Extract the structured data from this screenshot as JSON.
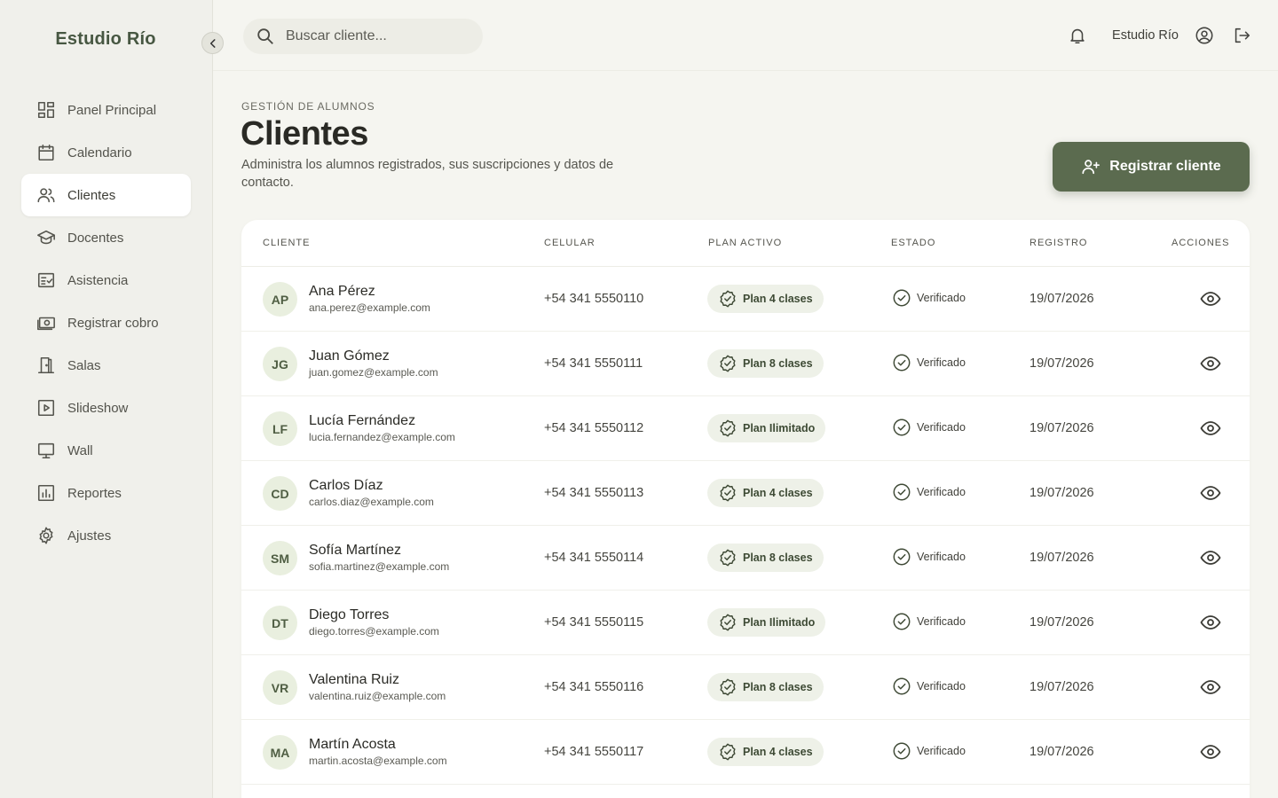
{
  "app": {
    "brand": "Estudio Río"
  },
  "sidebar": {
    "items": [
      {
        "label": "Panel Principal",
        "icon": "dashboard-icon",
        "active": false
      },
      {
        "label": "Calendario",
        "icon": "calendar-icon",
        "active": false
      },
      {
        "label": "Clientes",
        "icon": "users-icon",
        "active": true
      },
      {
        "label": "Docentes",
        "icon": "graduation-cap-icon",
        "active": false
      },
      {
        "label": "Asistencia",
        "icon": "checklist-icon",
        "active": false
      },
      {
        "label": "Registrar cobro",
        "icon": "cash-icon",
        "active": false
      },
      {
        "label": "Salas",
        "icon": "door-icon",
        "active": false
      },
      {
        "label": "Slideshow",
        "icon": "play-icon",
        "active": false
      },
      {
        "label": "Wall",
        "icon": "monitor-icon",
        "active": false
      },
      {
        "label": "Reportes",
        "icon": "chart-icon",
        "active": false
      },
      {
        "label": "Ajustes",
        "icon": "gear-icon",
        "active": false
      }
    ]
  },
  "topbar": {
    "search_placeholder": "Buscar cliente...",
    "studio_name": "Estudio Río"
  },
  "page": {
    "eyebrow": "GESTIÓN DE ALUMNOS",
    "title": "Clientes",
    "subtitle": "Administra los alumnos registrados, sus suscripciones y datos de contacto.",
    "cta_label": "Registrar cliente"
  },
  "table": {
    "headers": {
      "cliente": "CLIENTE",
      "celular": "CELULAR",
      "plan": "PLAN ACTIVO",
      "estado": "ESTADO",
      "registro": "REGISTRO",
      "acciones": "ACCIONES"
    },
    "rows": [
      {
        "initials": "AP",
        "name": "Ana Pérez",
        "email": "ana.perez@example.com",
        "phone": "+54 341 5550110",
        "plan": "Plan 4 clases",
        "status": "Verificado",
        "date": "19/07/2026"
      },
      {
        "initials": "JG",
        "name": "Juan Gómez",
        "email": "juan.gomez@example.com",
        "phone": "+54 341 5550111",
        "plan": "Plan 8 clases",
        "status": "Verificado",
        "date": "19/07/2026"
      },
      {
        "initials": "LF",
        "name": "Lucía Fernández",
        "email": "lucia.fernandez@example.com",
        "phone": "+54 341 5550112",
        "plan": "Plan Ilimitado",
        "status": "Verificado",
        "date": "19/07/2026"
      },
      {
        "initials": "CD",
        "name": "Carlos Díaz",
        "email": "carlos.diaz@example.com",
        "phone": "+54 341 5550113",
        "plan": "Plan 4 clases",
        "status": "Verificado",
        "date": "19/07/2026"
      },
      {
        "initials": "SM",
        "name": "Sofía Martínez",
        "email": "sofia.martinez@example.com",
        "phone": "+54 341 5550114",
        "plan": "Plan 8 clases",
        "status": "Verificado",
        "date": "19/07/2026"
      },
      {
        "initials": "DT",
        "name": "Diego Torres",
        "email": "diego.torres@example.com",
        "phone": "+54 341 5550115",
        "plan": "Plan Ilimitado",
        "status": "Verificado",
        "date": "19/07/2026"
      },
      {
        "initials": "VR",
        "name": "Valentina Ruiz",
        "email": "valentina.ruiz@example.com",
        "phone": "+54 341 5550116",
        "plan": "Plan 8 clases",
        "status": "Verificado",
        "date": "19/07/2026"
      },
      {
        "initials": "MA",
        "name": "Martín Acosta",
        "email": "martin.acosta@example.com",
        "phone": "+54 341 5550117",
        "plan": "Plan 4 clases",
        "status": "Verificado",
        "date": "19/07/2026"
      }
    ]
  },
  "colors": {
    "accent": "#5b6b4f",
    "brand_text": "#475742",
    "avatar_bg": "#e9efdf",
    "plan_bg": "#eef1e8",
    "page_bg": "#f5f5f0"
  }
}
